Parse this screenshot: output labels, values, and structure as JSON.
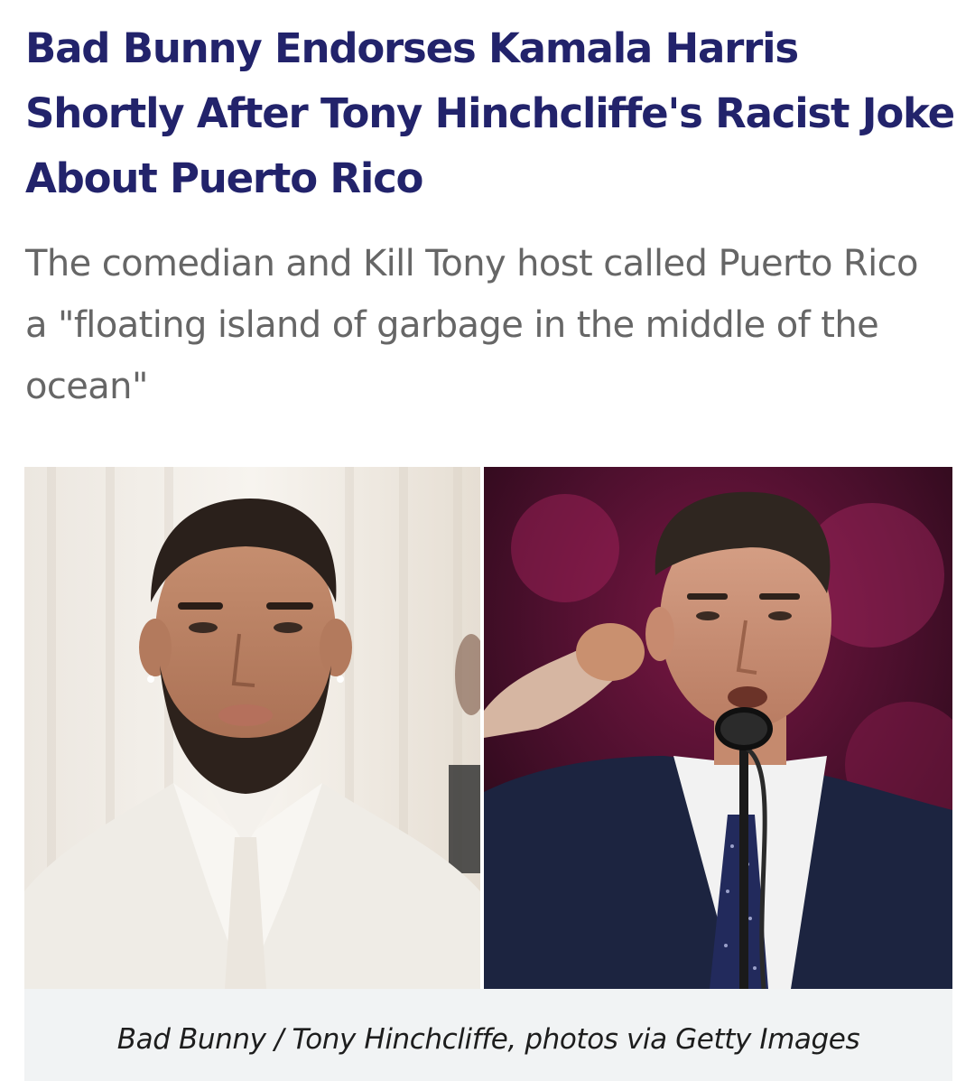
{
  "article": {
    "headline": "Bad Bunny Endorses Kamala Harris Shortly After Tony Hinchcliffe's Racist Joke About Puerto Rico",
    "dek": "The comedian and Kill Tony host called Puerto Rico a \"floating island of garbage in the middle of the ocean\"",
    "caption": "Bad Bunny / Tony Hinchcliffe, photos via Getty Images"
  },
  "colors": {
    "headline": "#22236b",
    "dek": "#666666",
    "caption_bg": "#f1f3f4",
    "caption_text": "#1d1d1d"
  }
}
